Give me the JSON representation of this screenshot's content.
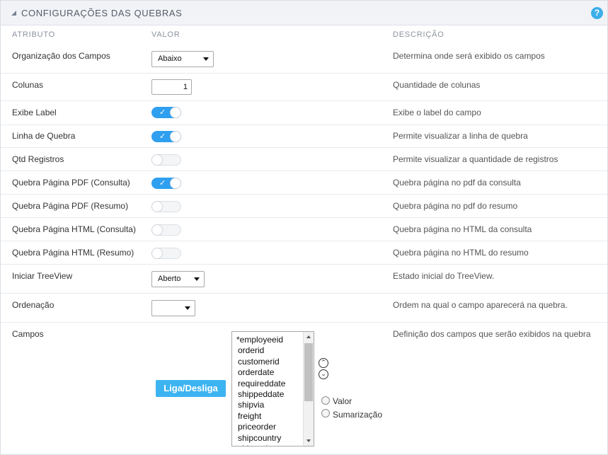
{
  "panel": {
    "title": "CONFIGURAÇÕES DAS QUEBRAS",
    "help_icon": "question-icon",
    "help_label": "?"
  },
  "columns": {
    "attribute": "ATRIBUTO",
    "value": "VALOR",
    "description": "DESCRIÇÃO"
  },
  "rows": {
    "organizacao": {
      "label": "Organização dos Campos",
      "value": "Abaixo",
      "description": "Determina onde será exibido os campos"
    },
    "colunas": {
      "label": "Colunas",
      "value": "1",
      "description": "Quantidade de colunas"
    },
    "exibe_label": {
      "label": "Exibe Label",
      "on": true,
      "description": "Exibe o label do campo"
    },
    "linha_quebra": {
      "label": "Linha de Quebra",
      "on": true,
      "description": "Permite visualizar a linha de quebra"
    },
    "qtd_registros": {
      "label": "Qtd Registros",
      "on": false,
      "description": "Permite visualizar a quantidade de registros"
    },
    "pdf_consulta": {
      "label": "Quebra Página PDF (Consulta)",
      "on": true,
      "description": "Quebra página no pdf da consulta"
    },
    "pdf_resumo": {
      "label": "Quebra Página PDF (Resumo)",
      "on": false,
      "description": "Quebra página no pdf do resumo"
    },
    "html_consulta": {
      "label": "Quebra Página HTML (Consulta)",
      "on": false,
      "description": "Quebra página no HTML da consulta"
    },
    "html_resumo": {
      "label": "Quebra Página HTML (Resumo)",
      "on": false,
      "description": "Quebra página no HTML do resumo"
    },
    "treeview": {
      "label": "Iniciar TreeView",
      "value": "Aberto",
      "description": "Estado inicial do TreeView."
    },
    "ordenacao": {
      "label": "Ordenação",
      "value": "",
      "description": "Ordem na qual o campo aparecerá na quebra."
    },
    "campos": {
      "label": "Campos",
      "description": "Definição dos campos que serão exibidos na quebra"
    }
  },
  "toggle_check": "✓",
  "fields": [
    "*employeeid",
    "orderid",
    "customerid",
    "orderdate",
    "requireddate",
    "shippeddate",
    "shipvia",
    "freight",
    "priceorder",
    "shipcountry",
    "shipregion"
  ],
  "order_buttons": {
    "up": "⌃",
    "down": "⌄"
  },
  "liga_button": "Liga/Desliga",
  "radios": {
    "valor": "Valor",
    "sumarizacao": "Sumarização"
  },
  "colors": {
    "accent": "#2f9ff0",
    "button": "#3db4f2",
    "help": "#3daee9"
  }
}
